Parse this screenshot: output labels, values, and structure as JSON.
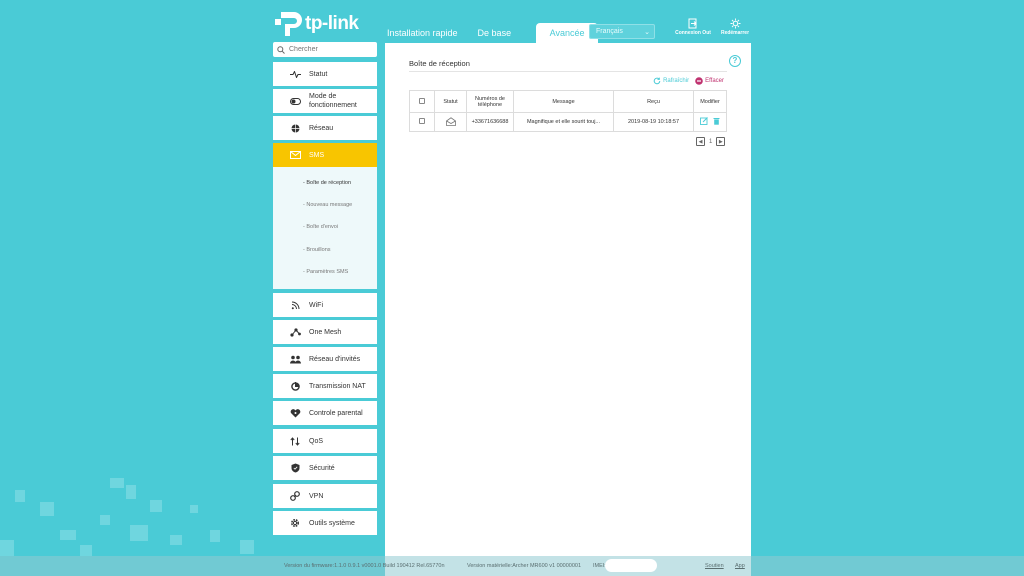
{
  "brand": {
    "name": "tp-link"
  },
  "tabs": [
    {
      "label": "Installation rapide"
    },
    {
      "label": "De base"
    },
    {
      "label": "Avancée",
      "active": true
    }
  ],
  "language": {
    "selected": "Français"
  },
  "top_actions": {
    "logout": "Connexion Out",
    "reboot": "Redémarrer"
  },
  "search": {
    "placeholder": "Chercher"
  },
  "sidebar": {
    "items": [
      {
        "label": "Statut",
        "icon": "pulse-icon"
      },
      {
        "label": "Mode de fonctionnement",
        "icon": "toggle-icon"
      },
      {
        "label": "Réseau",
        "icon": "globe-icon"
      },
      {
        "label": "SMS",
        "icon": "envelope-icon",
        "active": true
      },
      {
        "label": "WiFi",
        "icon": "wifi-icon"
      },
      {
        "label": "One Mesh",
        "icon": "mesh-icon"
      },
      {
        "label": "Réseau d'invités",
        "icon": "guests-icon"
      },
      {
        "label": "Transmission NAT",
        "icon": "nat-icon"
      },
      {
        "label": "Controle parental",
        "icon": "parental-icon"
      },
      {
        "label": "QoS",
        "icon": "qos-icon"
      },
      {
        "label": "Sécurité",
        "icon": "shield-icon"
      },
      {
        "label": "VPN",
        "icon": "vpn-icon"
      },
      {
        "label": "Outils système",
        "icon": "gear-icon"
      }
    ],
    "sms_submenu": [
      {
        "label": "- Boîte de réception",
        "active": true
      },
      {
        "label": "- Nouveau message"
      },
      {
        "label": "- Boîte d'envoi"
      },
      {
        "label": "- Brouillons"
      },
      {
        "label": "- Paramètres SMS"
      }
    ]
  },
  "main": {
    "title": "Boîte de réception",
    "refresh_label": "Rafraîchir",
    "delete_label": "Effacer",
    "table": {
      "headers": [
        "",
        "Statut",
        "Numéros de téléphone",
        "Message",
        "Reçu",
        "Modifier"
      ],
      "rows": [
        {
          "phone": "+33671636688",
          "message": "Magnifique et elle sourit touj...",
          "received": "2019-08-19 10:18:57"
        }
      ]
    },
    "pager": {
      "page": "1"
    }
  },
  "footer": {
    "firmware": "Version du firmware:1.1.0 0.9.1 v0001.0 Build 190412 Rel.65770n",
    "hardware": "Version matérielle:Archer MR600 v1 00000001",
    "imei": "IMEI:8",
    "support": "Soutien",
    "app": "App"
  },
  "colors": {
    "accent": "#4acbd6",
    "active_nav": "#f8c500",
    "delete": "#c03370"
  }
}
